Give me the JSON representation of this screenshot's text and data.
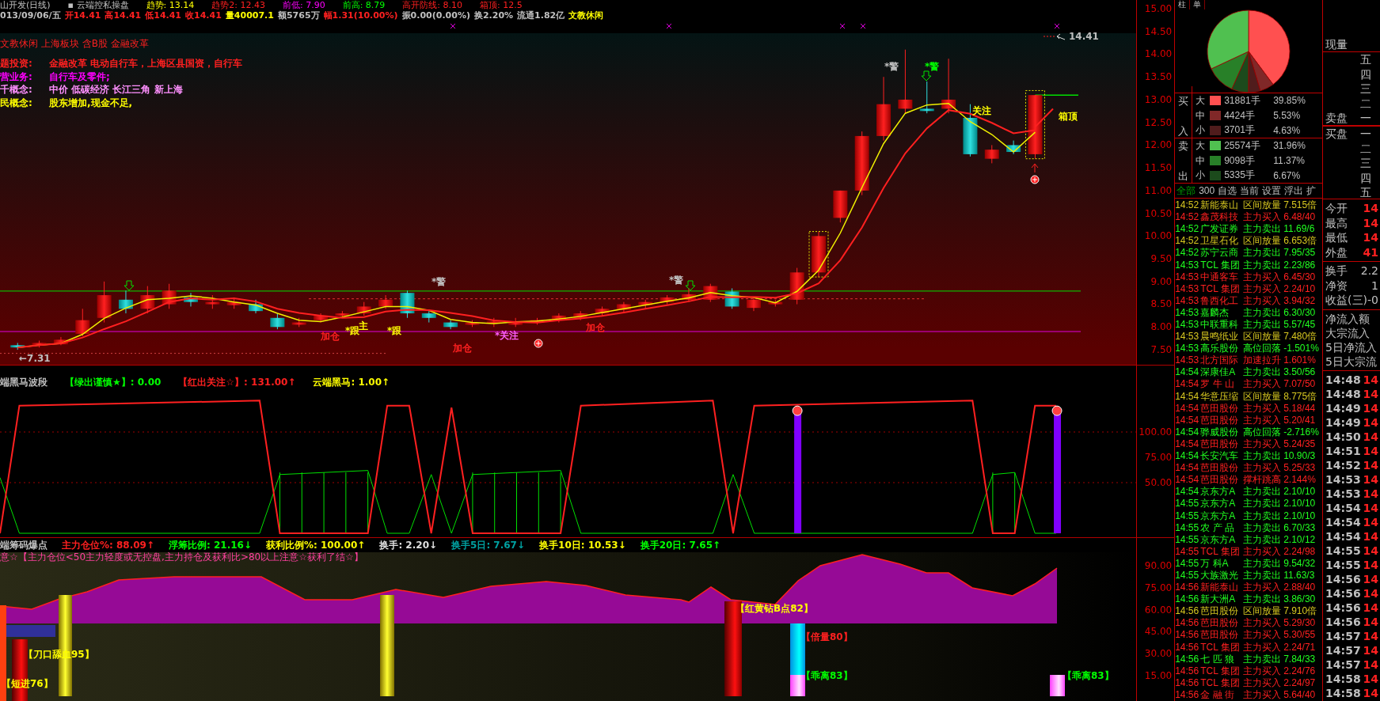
{
  "header": {
    "top_row": [
      {
        "text": "山开发(日线)",
        "color": "#c0c0c0"
      },
      {
        "text": "▪ 云端控私操盘",
        "color": "#c0c0c0"
      },
      {
        "text": "趋势: 13.14",
        "color": "#ffff00"
      },
      {
        "text": "趋势2: 12.43",
        "color": "#ff2020"
      },
      {
        "text": "前低: 7.90",
        "color": "#ff00ff"
      },
      {
        "text": "前高: 8.79",
        "color": "#00ff00"
      },
      {
        "text": "高开防线: 8.10",
        "color": "#ff2020"
      },
      {
        "text": "箱顶: 12.5",
        "color": "#ff2020"
      }
    ],
    "quote_row": [
      {
        "text": "013/09/06/五",
        "color": "#c0c0c0"
      },
      {
        "text": "开14.41",
        "color": "#ff2020"
      },
      {
        "text": "高14.41",
        "color": "#ff2020"
      },
      {
        "text": "低14.41",
        "color": "#ff2020"
      },
      {
        "text": "收14.41",
        "color": "#ff2020"
      },
      {
        "text": "量40007.1",
        "color": "#ffff00"
      },
      {
        "text": "额5765万",
        "color": "#c0c0c0"
      },
      {
        "text": "幅1.31(10.00%)",
        "color": "#ff2020"
      },
      {
        "text": "振0.00(0.00%)",
        "color": "#c0c0c0"
      },
      {
        "text": "换2.20%",
        "color": "#c0c0c0"
      },
      {
        "text": "流通1.82亿",
        "color": "#c0c0c0"
      },
      {
        "text": "文教休闲",
        "color": "#ffff00"
      }
    ],
    "sector": "文教休闲 上海板块 含B股 金融改革",
    "info": [
      {
        "label": "题投资:",
        "value": "金融改革 电动自行车，上海区县国资，自行车",
        "color": "#ff2020"
      },
      {
        "label": "营业务:",
        "value": "自行车及零件;",
        "color": "#ff00ff"
      },
      {
        "label": "千概念:",
        "value": "中价 低碳经济 长江三角 新上海",
        "color": "#ff90ff"
      },
      {
        "label": "民概念:",
        "value": "股东增加,现金不足,",
        "color": "#ffff00"
      }
    ]
  },
  "annotations": [
    {
      "text": "14.41",
      "color": "#c0c0c0"
    },
    {
      "text": "*警",
      "color": "#c0c0c0"
    },
    {
      "text": "*警",
      "color": "#00ff00"
    },
    {
      "text": "关注",
      "color": "#ffff00"
    },
    {
      "text": "箱顶",
      "color": "#ffff00"
    },
    {
      "text": "*警",
      "color": "#c0c0c0"
    },
    {
      "text": "*警",
      "color": "#c0c0c0"
    },
    {
      "text": "加仓",
      "color": "#ff2020"
    },
    {
      "text": "*跟",
      "color": "#ffff00"
    },
    {
      "text": "主",
      "color": "#ffff00"
    },
    {
      "text": "*跟",
      "color": "#ffff00"
    },
    {
      "text": "加仓",
      "color": "#ff2020"
    },
    {
      "text": "*关注",
      "color": "#ff60ff"
    },
    {
      "text": "加仓",
      "color": "#ff2020"
    },
    {
      "text": "←7.31",
      "color": "#c0c0c0"
    }
  ],
  "price_ticks": [
    "15.00",
    "14.50",
    "14.00",
    "13.50",
    "13.00",
    "12.50",
    "12.00",
    "11.50",
    "11.00",
    "10.50",
    "10.00",
    "9.50",
    "9.00",
    "8.50",
    "8.00",
    "7.50"
  ],
  "wave_panel": {
    "items": [
      {
        "text": "端黑马波段",
        "color": "#c0c0c0"
      },
      {
        "text": "【绿出谨慎★】: 0.00",
        "color": "#00ff00"
      },
      {
        "text": "【红出关注☆】: 131.00↑",
        "color": "#ff2020"
      },
      {
        "text": "云端黑马: 1.00↑",
        "color": "#ffff00"
      }
    ],
    "ticks": [
      "100.00",
      "75.00",
      "50.00"
    ]
  },
  "chip_panel": {
    "items": [
      {
        "text": "端筹码爆点",
        "color": "#c0c0c0"
      },
      {
        "text": "主力仓位%: 88.09↑",
        "color": "#ff2020"
      },
      {
        "text": "浮筹比例: 21.16↓",
        "color": "#00ff00"
      },
      {
        "text": "获利比例%: 100.00↑",
        "color": "#ffff00"
      },
      {
        "text": "换手: 2.20↓",
        "color": "#e0e0e0"
      },
      {
        "text": "换手5日: 7.67↓",
        "color": "#00a0a0"
      },
      {
        "text": "换手10日: 10.53↓",
        "color": "#ffff00"
      },
      {
        "text": "换手20日: 7.65↑",
        "color": "#00ff00"
      }
    ],
    "note": "意☆【主力仓位<50主力轻度或无控盘,主力持仓及获利比>80以上注意☆获利了结☆】",
    "signals": [
      {
        "text": "【短进76】",
        "color": "#ffff00"
      },
      {
        "text": "【刀口舔血95】",
        "color": "#ffff00"
      },
      {
        "text": "【红黄钻B点82】",
        "color": "#ffff00"
      },
      {
        "text": "【倍量80】",
        "color": "#ff2020"
      },
      {
        "text": "【乖离83】",
        "color": "#00ff00"
      },
      {
        "text": "【乖离83】",
        "color": "#00ff00"
      }
    ],
    "ticks": [
      "90.00",
      "75.00",
      "60.00",
      "45.00",
      "30.00",
      "15.00"
    ]
  },
  "side_tabs": [
    "柱",
    "单"
  ],
  "flow_groups": [
    {
      "label": "买入",
      "rows": [
        {
          "size": "大",
          "amount": "31881手",
          "percent": "39.85%",
          "color": "#ff5050"
        },
        {
          "size": "中",
          "amount": "4424手",
          "percent": "5.53%",
          "color": "#802828"
        },
        {
          "size": "小",
          "amount": "3701手",
          "percent": "4.63%",
          "color": "#501c1c"
        }
      ]
    },
    {
      "label": "卖出",
      "rows": [
        {
          "size": "大",
          "amount": "25574手",
          "percent": "31.96%",
          "color": "#50c050"
        },
        {
          "size": "中",
          "amount": "9098手",
          "percent": "11.37%",
          "color": "#288028"
        },
        {
          "size": "小",
          "amount": "5335手",
          "percent": "6.67%",
          "color": "#1c4a1c"
        }
      ]
    }
  ],
  "alert_tabs": [
    {
      "label": "全部",
      "selected": true
    },
    {
      "label": "300",
      "selected": false
    },
    {
      "label": "自选",
      "selected": false
    },
    {
      "label": "当前",
      "selected": false
    },
    {
      "label": "设置",
      "selected": false
    },
    {
      "label": "浮出",
      "selected": false
    },
    {
      "label": "扩",
      "selected": false
    }
  ],
  "alerts": [
    {
      "time": "14:52",
      "name": "新能泰山",
      "event": "区间放量",
      "value": "7.515倍",
      "color": "#d8c820"
    },
    {
      "time": "14:52",
      "name": "鑫茂科技",
      "event": "主力买入",
      "value": "6.48/40",
      "color": "#ff2020"
    },
    {
      "time": "14:52",
      "name": "广发证券",
      "event": "主力卖出",
      "value": "11.69/6",
      "color": "#20ff20"
    },
    {
      "time": "14:52",
      "name": "卫星石化",
      "event": "区间放量",
      "value": "6.653倍",
      "color": "#d8c820"
    },
    {
      "time": "14:52",
      "name": "苏宁云商",
      "event": "主力卖出",
      "value": "7.95/35",
      "color": "#20ff20"
    },
    {
      "time": "14:53",
      "name": "TCL 集团",
      "event": "主力卖出",
      "value": "2.23/86",
      "color": "#20ff20"
    },
    {
      "time": "14:53",
      "name": "中通客车",
      "event": "主力买入",
      "value": "6.45/30",
      "color": "#ff2020"
    },
    {
      "time": "14:53",
      "name": "TCL 集团",
      "event": "主力买入",
      "value": "2.24/10",
      "color": "#ff2020"
    },
    {
      "time": "14:53",
      "name": "鲁西化工",
      "event": "主力买入",
      "value": "3.94/32",
      "color": "#ff2020"
    },
    {
      "time": "14:53",
      "name": "嘉麟杰",
      "event": "主力卖出",
      "value": "6.30/30",
      "color": "#20ff20"
    },
    {
      "time": "14:53",
      "name": "中联重科",
      "event": "主力卖出",
      "value": "5.57/45",
      "color": "#20ff20"
    },
    {
      "time": "14:53",
      "name": "晨鸣纸业",
      "event": "区间放量",
      "value": "7.480倍",
      "color": "#d8c820"
    },
    {
      "time": "14:53",
      "name": "高乐股份",
      "event": "高位回落",
      "value": "-1.501%",
      "color": "#20ff20"
    },
    {
      "time": "14:53",
      "name": "北方国际",
      "event": "加速拉升",
      "value": "1.601%",
      "color": "#ff2020"
    },
    {
      "time": "14:54",
      "name": "深康佳A",
      "event": "主力卖出",
      "value": "3.50/56",
      "color": "#20ff20"
    },
    {
      "time": "14:54",
      "name": "罗 牛 山",
      "event": "主力买入",
      "value": "7.07/50",
      "color": "#ff2020"
    },
    {
      "time": "14:54",
      "name": "华意压缩",
      "event": "区间放量",
      "value": "8.775倍",
      "color": "#d8c820"
    },
    {
      "time": "14:54",
      "name": "芭田股份",
      "event": "主力买入",
      "value": "5.18/44",
      "color": "#ff2020"
    },
    {
      "time": "14:54",
      "name": "芭田股份",
      "event": "主力买入",
      "value": "5.20/41",
      "color": "#ff2020"
    },
    {
      "time": "14:54",
      "name": "骅威股份",
      "event": "高位回落",
      "value": "-2.716%",
      "color": "#20ff20"
    },
    {
      "time": "14:54",
      "name": "芭田股份",
      "event": "主力买入",
      "value": "5.24/35",
      "color": "#ff2020"
    },
    {
      "time": "14:54",
      "name": "长安汽车",
      "event": "主力卖出",
      "value": "10.90/3",
      "color": "#20ff20"
    },
    {
      "time": "14:54",
      "name": "芭田股份",
      "event": "主力买入",
      "value": "5.25/33",
      "color": "#ff2020"
    },
    {
      "time": "14:54",
      "name": "芭田股份",
      "event": "撑杆跳高",
      "value": "2.144%",
      "color": "#ff2020"
    },
    {
      "time": "14:54",
      "name": "京东方A",
      "event": "主力卖出",
      "value": "2.10/10",
      "color": "#20ff20"
    },
    {
      "time": "14:55",
      "name": "京东方A",
      "event": "主力卖出",
      "value": "2.10/10",
      "color": "#20ff20"
    },
    {
      "time": "14:55",
      "name": "京东方A",
      "event": "主力卖出",
      "value": "2.10/10",
      "color": "#20ff20"
    },
    {
      "time": "14:55",
      "name": "农 产 品",
      "event": "主力卖出",
      "value": "6.70/33",
      "color": "#20ff20"
    },
    {
      "time": "14:55",
      "name": "京东方A",
      "event": "主力卖出",
      "value": "2.10/12",
      "color": "#20ff20"
    },
    {
      "time": "14:55",
      "name": "TCL 集团",
      "event": "主力买入",
      "value": "2.24/98",
      "color": "#ff2020"
    },
    {
      "time": "14:55",
      "name": "万 科A",
      "event": "主力卖出",
      "value": "9.54/32",
      "color": "#20ff20"
    },
    {
      "time": "14:55",
      "name": "大族激光",
      "event": "主力卖出",
      "value": "11.63/3",
      "color": "#20ff20"
    },
    {
      "time": "14:56",
      "name": "新能泰山",
      "event": "主力买入",
      "value": "2.88/40",
      "color": "#ff2020"
    },
    {
      "time": "14:56",
      "name": "新大洲A",
      "event": "主力卖出",
      "value": "3.86/30",
      "color": "#20ff20"
    },
    {
      "time": "14:56",
      "name": "芭田股份",
      "event": "区间放量",
      "value": "7.910倍",
      "color": "#d8c820"
    },
    {
      "time": "14:56",
      "name": "芭田股份",
      "event": "主力买入",
      "value": "5.29/30",
      "color": "#ff2020"
    },
    {
      "time": "14:56",
      "name": "芭田股份",
      "event": "主力买入",
      "value": "5.30/55",
      "color": "#ff2020"
    },
    {
      "time": "14:56",
      "name": "TCL 集团",
      "event": "主力买入",
      "value": "2.24/71",
      "color": "#ff2020"
    },
    {
      "time": "14:56",
      "name": "七 匹 狼",
      "event": "主力卖出",
      "value": "7.84/33",
      "color": "#20ff20"
    },
    {
      "time": "14:56",
      "name": "TCL 集团",
      "event": "主力买入",
      "value": "2.24/76",
      "color": "#ff2020"
    },
    {
      "time": "14:56",
      "name": "TCL 集团",
      "event": "主力买入",
      "value": "2.24/97",
      "color": "#ff2020"
    },
    {
      "time": "14:56",
      "name": "金 融 街",
      "event": "主力买入",
      "value": "5.64/40",
      "color": "#ff2020"
    }
  ],
  "quote_panel": {
    "volume_label": "现量",
    "sell_label": "卖盘",
    "sell_levels": [
      "五",
      "四",
      "三",
      "二",
      "一"
    ],
    "buy_label": "买盘",
    "buy_levels": [
      "一",
      "二",
      "三",
      "四",
      "五"
    ],
    "prices": [
      {
        "label": "今开",
        "value": "14"
      },
      {
        "label": "最高",
        "value": "14"
      },
      {
        "label": "最低",
        "value": "14"
      },
      {
        "label": "外盘",
        "value": "41"
      }
    ],
    "stats": [
      {
        "label": "换手",
        "value": "2.2"
      },
      {
        "label": "净资",
        "value": "1"
      },
      {
        "label": "收益(三)",
        "value": "-0"
      }
    ],
    "flows": [
      "净流入额",
      "大宗流入",
      "5日净流入",
      "5日大宗流"
    ],
    "ticks": [
      {
        "time": "14:48",
        "price": "14"
      },
      {
        "time": "14:48",
        "price": "14"
      },
      {
        "time": "14:49",
        "price": "14"
      },
      {
        "time": "14:49",
        "price": "14"
      },
      {
        "time": "14:50",
        "price": "14"
      },
      {
        "time": "14:51",
        "price": "14"
      },
      {
        "time": "14:52",
        "price": "14"
      },
      {
        "time": "14:53",
        "price": "14"
      },
      {
        "time": "14:53",
        "price": "14"
      },
      {
        "time": "14:54",
        "price": "14"
      },
      {
        "time": "14:54",
        "price": "14"
      },
      {
        "time": "14:54",
        "price": "14"
      },
      {
        "time": "14:55",
        "price": "14"
      },
      {
        "time": "14:55",
        "price": "14"
      },
      {
        "time": "14:56",
        "price": "14"
      },
      {
        "time": "14:56",
        "price": "14"
      },
      {
        "time": "14:56",
        "price": "14"
      },
      {
        "time": "14:56",
        "price": "14"
      },
      {
        "time": "14:57",
        "price": "14"
      },
      {
        "time": "14:57",
        "price": "14"
      },
      {
        "time": "14:57",
        "price": "14"
      },
      {
        "time": "14:58",
        "price": "14"
      },
      {
        "time": "14:58",
        "price": "14"
      }
    ]
  }
}
